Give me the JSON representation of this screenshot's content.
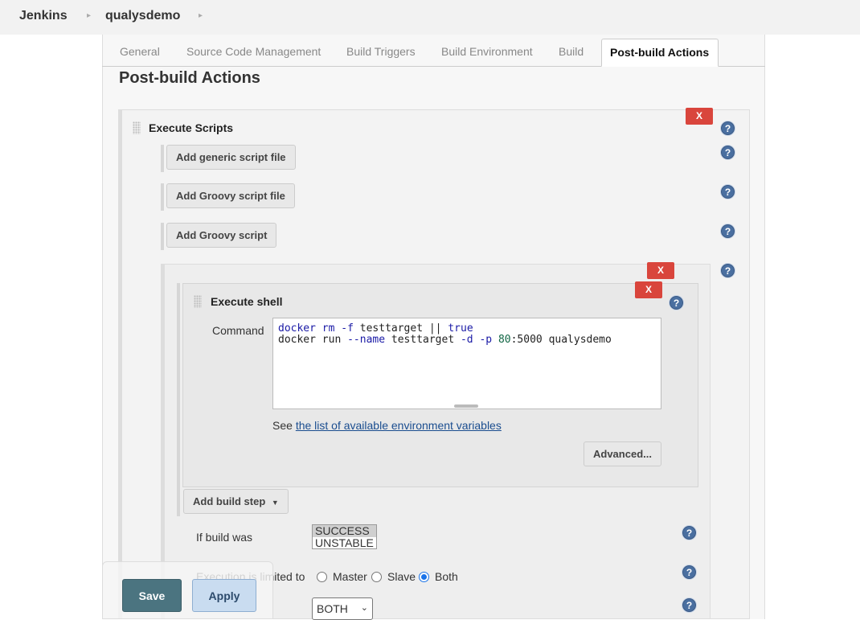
{
  "breadcrumb": {
    "root": "Jenkins",
    "project": "qualysdemo",
    "separator": "▸"
  },
  "tabs": [
    {
      "label": "General",
      "active": false
    },
    {
      "label": "Source Code Management",
      "active": false
    },
    {
      "label": "Build Triggers",
      "active": false
    },
    {
      "label": "Build Environment",
      "active": false
    },
    {
      "label": "Build",
      "active": false
    },
    {
      "label": "Post-build Actions",
      "active": true
    }
  ],
  "section_title": "Post-build Actions",
  "execute_scripts": {
    "title": "Execute Scripts",
    "delete_label": "X",
    "buttons": {
      "add_generic": "Add generic script file",
      "add_groovy_file": "Add Groovy script file",
      "add_groovy_script": "Add Groovy script"
    }
  },
  "execute_shell": {
    "title": "Execute shell",
    "delete_label": "X",
    "command_label": "Command",
    "command_lines": [
      "docker rm -f testtarget || true",
      "docker run --name testtarget -d -p 80:5000 qualysdemo"
    ],
    "see_prefix": "See ",
    "env_link": "the list of available environment variables",
    "advanced": "Advanced..."
  },
  "add_build_step": "Add build step",
  "if_build_was": {
    "label": "If build was",
    "options": [
      "SUCCESS",
      "UNSTABLE"
    ],
    "selected": "SUCCESS"
  },
  "execution": {
    "label": "Execution is limited to",
    "options": [
      "Master",
      "Slave",
      "Both"
    ],
    "selected": "Both"
  },
  "target_select": {
    "value": "BOTH"
  },
  "help_symbol": "?",
  "footer": {
    "save": "Save",
    "apply": "Apply"
  }
}
